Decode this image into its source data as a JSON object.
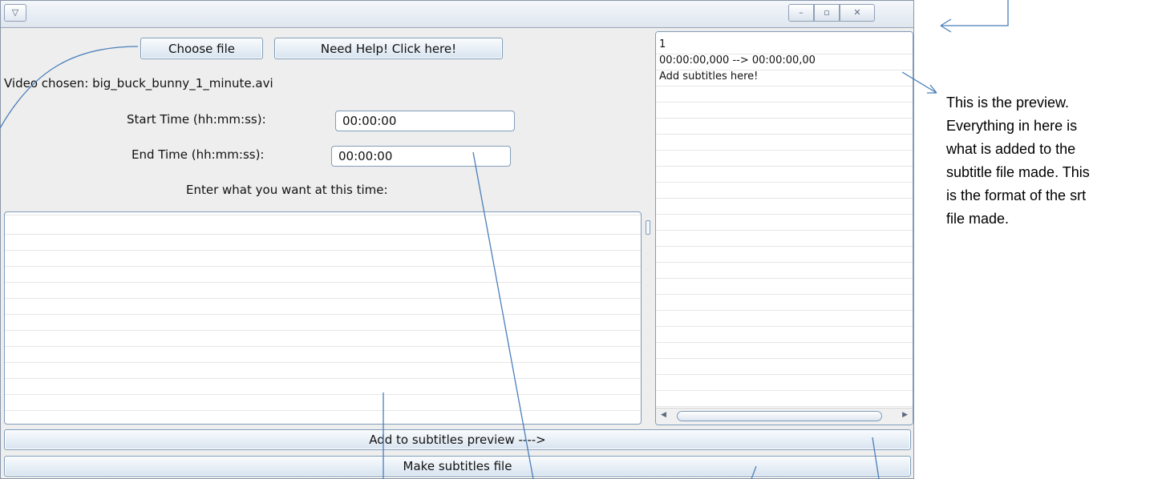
{
  "window": {
    "sysmenu_glyph": "▽",
    "minimize_glyph": "–",
    "maximize_glyph": "▫",
    "close_glyph": "✕"
  },
  "toolbar": {
    "choose_file_label": "Choose file",
    "help_label": "Need Help! Click here!"
  },
  "video": {
    "chosen_text": "Video chosen: big_buck_bunny_1_minute.avi"
  },
  "form": {
    "start_label": "Start Time (hh:mm:ss):",
    "start_value": "00:00:00",
    "end_label": "End Time (hh:mm:ss):",
    "end_value": "00:00:00",
    "enter_label": "Enter what you want at this time:",
    "subtitle_text": ""
  },
  "preview": {
    "lines": [
      "1",
      "00:00:00,000 --> 00:00:00,00",
      "Add subtitles here!"
    ]
  },
  "actions": {
    "add_label": "Add to subtitles preview ---->",
    "make_label": "Make subtitles file"
  },
  "annotation": {
    "text": "This is the preview. Everything in here is what is added to the subtitle file made. This is the format of the srt file made."
  },
  "colors": {
    "annotation_line": "#4a7ebb",
    "button_border": "#7f9db9"
  }
}
